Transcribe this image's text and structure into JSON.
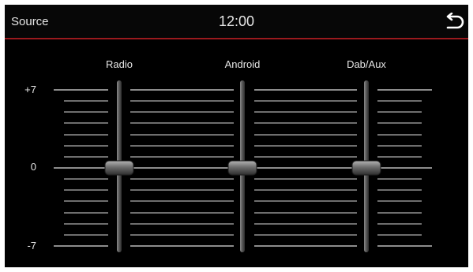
{
  "header": {
    "source_label": "Source",
    "time": "12:00",
    "back_icon": "return-arrow-icon",
    "accent_color": "#9a1a1e"
  },
  "scale": {
    "max_label": "+7",
    "mid_label": "0",
    "min_label": "-7",
    "max": 7,
    "min": -7
  },
  "channels": [
    {
      "label": "Radio",
      "value": 0
    },
    {
      "label": "Android",
      "value": 0
    },
    {
      "label": "Dab/Aux",
      "value": 0
    }
  ]
}
